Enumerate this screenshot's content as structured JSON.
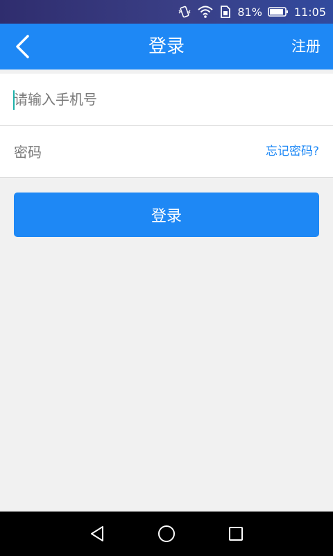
{
  "status_bar": {
    "battery_percent": "81%",
    "time": "11:05",
    "icons": [
      "vibrate-icon",
      "wifi-icon",
      "sim-icon",
      "battery-icon"
    ]
  },
  "header": {
    "title": "登录",
    "register_label": "注册",
    "back_icon": "back-arrow-icon"
  },
  "form": {
    "phone_placeholder": "请输入手机号",
    "phone_value": "",
    "password_placeholder": "密码",
    "password_value": "",
    "forgot_label": "忘记密码?"
  },
  "login_button_label": "登录",
  "colors": {
    "accent": "#1e88f5",
    "background": "#f1f1f1",
    "status_bar": "#2f2d6e",
    "nav_bar": "#000000"
  },
  "nav_bar": {
    "icons": [
      "back-triangle-icon",
      "home-circle-icon",
      "recents-square-icon"
    ]
  }
}
